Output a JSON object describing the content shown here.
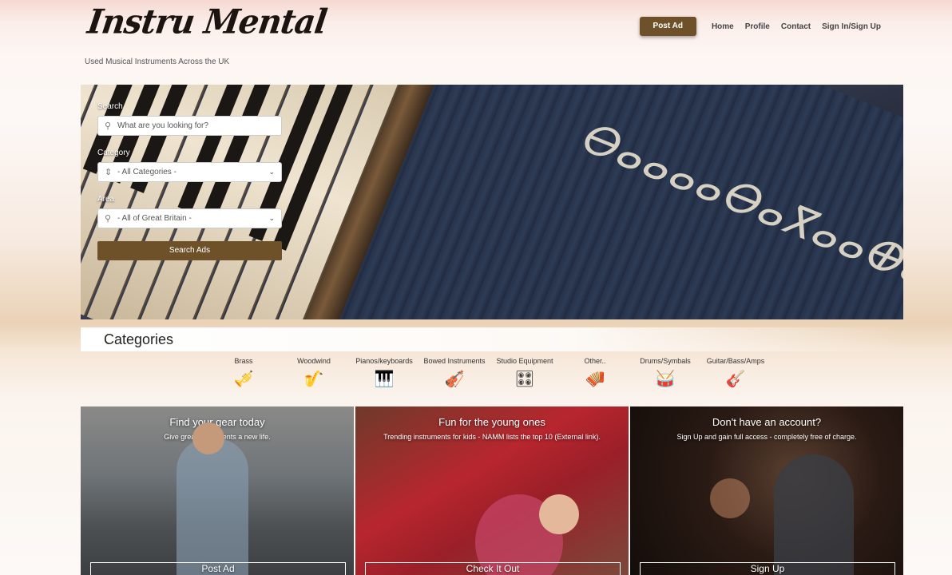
{
  "header": {
    "logo_text": "Instru Mental",
    "tagline": "Used Musical Instruments Across the UK",
    "post_ad": "Post Ad",
    "nav": [
      "Home",
      "Profile",
      "Contact",
      "Sign In/Sign Up"
    ]
  },
  "hero": {
    "script_text": "ⴱⴰⴰⴰⴰⴱⴰⴳⴰⴰⴲⴰ",
    "search_label": "Search",
    "search_placeholder": "What are you looking for?",
    "category_label": "Category",
    "category_value": "- All Categories -",
    "area_label": "Area",
    "area_value": "- All of Great Britain -",
    "search_button": "Search Ads"
  },
  "categories": {
    "title": "Categories",
    "items": [
      {
        "label": "Brass",
        "icon": "trumpet-icon",
        "glyph": "🎺"
      },
      {
        "label": "Woodwind",
        "icon": "clarinet-icon",
        "glyph": "🎷"
      },
      {
        "label": "Pianos/keyboards",
        "icon": "piano-icon",
        "glyph": "🎹"
      },
      {
        "label": "Bowed Instruments",
        "icon": "violin-icon",
        "glyph": "🎻"
      },
      {
        "label": "Studio Equipment",
        "icon": "mixer-icon",
        "glyph": "🎛"
      },
      {
        "label": "Other..",
        "icon": "accordion-icon",
        "glyph": "🪗"
      },
      {
        "label": "Drums/Symbals",
        "icon": "drum-kit-icon",
        "glyph": "🥁"
      },
      {
        "label": "Guitar/Bass/Amps",
        "icon": "guitar-icon",
        "glyph": "🎸"
      }
    ]
  },
  "cards": [
    {
      "title": "Find your gear today",
      "subtitle": "Give great instruments a new life.",
      "cta": "Post Ad"
    },
    {
      "title": "Fun for the young ones",
      "subtitle": "Trending instruments for kids - NAMM lists the top 10 (External link).",
      "cta": "Check It Out"
    },
    {
      "title": "Don't have an account?",
      "subtitle": "Sign Up and gain full access - completely free of charge.",
      "cta": "Sign Up"
    }
  ],
  "colors": {
    "accent": "#6e5128"
  }
}
